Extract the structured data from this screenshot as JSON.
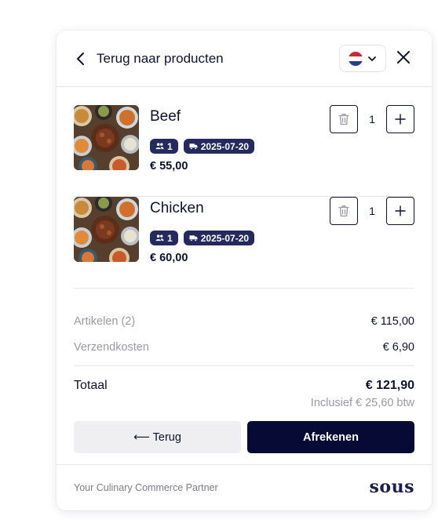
{
  "header": {
    "back_label": "Terug naar producten",
    "language": "nl",
    "icons": {
      "back": "chevron-left-icon",
      "chevron": "chevron-down-icon",
      "close": "close-icon"
    }
  },
  "cart": {
    "items": [
      {
        "name": "Beef",
        "people": "1",
        "delivery_date": "2025-07-20",
        "price": "€ 55,00",
        "quantity": "1"
      },
      {
        "name": "Chicken",
        "people": "1",
        "delivery_date": "2025-07-20",
        "price": "€ 60,00",
        "quantity": "1"
      }
    ]
  },
  "summary": {
    "items_label": "Artikelen (2)",
    "items_value": "€ 115,00",
    "shipping_label": "Verzendkosten",
    "shipping_value": "€ 6,90",
    "total_label": "Totaal",
    "total_value": "€ 121,90",
    "vat_note": "Inclusief € 25,60 btw"
  },
  "actions": {
    "back_label": "⟵ Terug",
    "checkout_label": "Afrekenen"
  },
  "footer": {
    "tagline": "Your Culinary Commerce Partner",
    "logo_text": "sous"
  },
  "colors": {
    "navy": "#060a35",
    "badge": "#242a5e",
    "muted": "#9a9aa3",
    "divider": "#e6e7ec"
  }
}
